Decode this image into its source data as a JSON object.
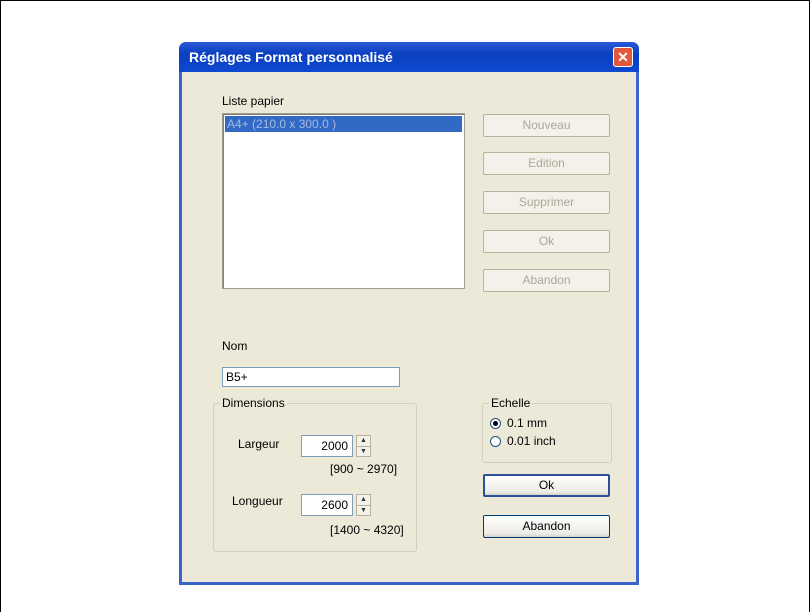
{
  "dialog": {
    "title": "Réglages Format personnalisé",
    "close_icon": "close-icon"
  },
  "paper_list": {
    "label": "Liste papier",
    "items": [
      "A4+ (210.0 x 300.0 )"
    ]
  },
  "side_buttons": {
    "new": "Nouveau",
    "edit": "Edition",
    "delete": "Supprimer",
    "ok": "Ok",
    "cancel": "Abandon"
  },
  "name": {
    "label": "Nom",
    "value": "B5+"
  },
  "dimensions": {
    "title": "Dimensions",
    "width_label": "Largeur",
    "width_value": "2000",
    "width_range": "[900 ~ 2970]",
    "length_label": "Longueur",
    "length_value": "2600",
    "length_range": "[1400 ~ 4320]"
  },
  "scale": {
    "title": "Echelle",
    "options": [
      "0.1 mm",
      "0.01 inch"
    ],
    "selected": "0.1 mm"
  },
  "footer_buttons": {
    "ok": "Ok",
    "cancel": "Abandon"
  }
}
